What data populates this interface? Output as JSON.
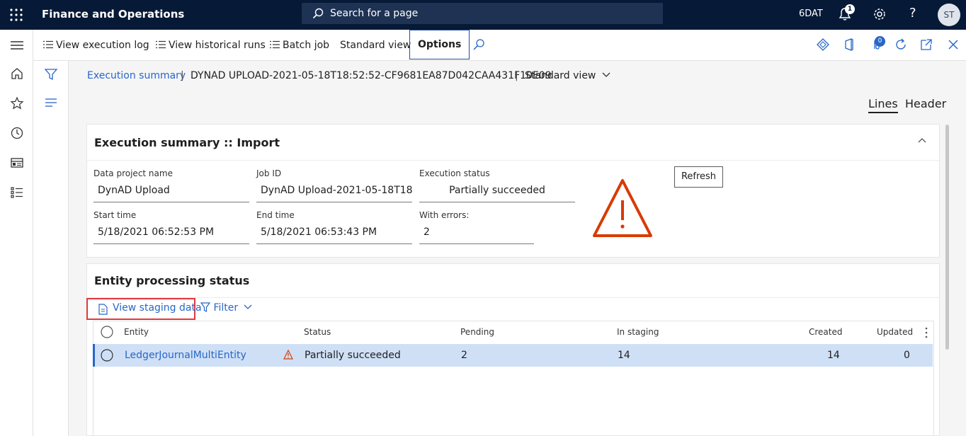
{
  "topbar": {
    "app_title": "Finance and Operations",
    "search_placeholder": "Search for a page",
    "company": "6DAT",
    "notifications_count": "1",
    "help": "?",
    "user_initials": "ST"
  },
  "actionbar": {
    "view_execution_log": "View execution log",
    "view_historical_runs": "View historical runs",
    "batch_job": "Batch job",
    "standard_view": "Standard view",
    "options": "Options",
    "attachments_count": "0"
  },
  "breadcrumb": {
    "root": "Execution summary",
    "separator": "|",
    "record": "DYNAD UPLOAD-2021-05-18T18:52:52-CF9681EA87D042CAA431F10E09",
    "view": "Standard view"
  },
  "tabs": {
    "lines": "Lines",
    "header": "Header"
  },
  "summary": {
    "title": "Execution summary :: Import",
    "refresh": "Refresh",
    "fields": {
      "data_project_name": {
        "label": "Data project name",
        "value": "DynAD Upload"
      },
      "job_id": {
        "label": "Job ID",
        "value": "DynAD Upload-2021-05-18T18:..."
      },
      "execution_status": {
        "label": "Execution status",
        "value": "Partially succeeded"
      },
      "start_time": {
        "label": "Start time",
        "value": "5/18/2021 06:52:53 PM"
      },
      "end_time": {
        "label": "End time",
        "value": "5/18/2021 06:53:43 PM"
      },
      "with_errors": {
        "label": "With errors:",
        "value": "2"
      }
    },
    "warning_icon": "warning-triangle-icon",
    "warning_color": "#d83b01"
  },
  "entity": {
    "title": "Entity processing status",
    "view_staging_data": "View staging data",
    "filter": "Filter",
    "columns": [
      "Entity",
      "Status",
      "Pending",
      "In staging",
      "Created",
      "Updated"
    ],
    "rows": [
      {
        "entity": "LedgerJournalMultiEntity",
        "status": "Partially succeeded",
        "pending": "2",
        "in_staging": "14",
        "created": "14",
        "updated": "0"
      }
    ]
  },
  "colors": {
    "topbar": "#061a37",
    "accent": "#2866c8",
    "highlight_box": "#e0393e",
    "selected_row": "#cfe0f6"
  }
}
